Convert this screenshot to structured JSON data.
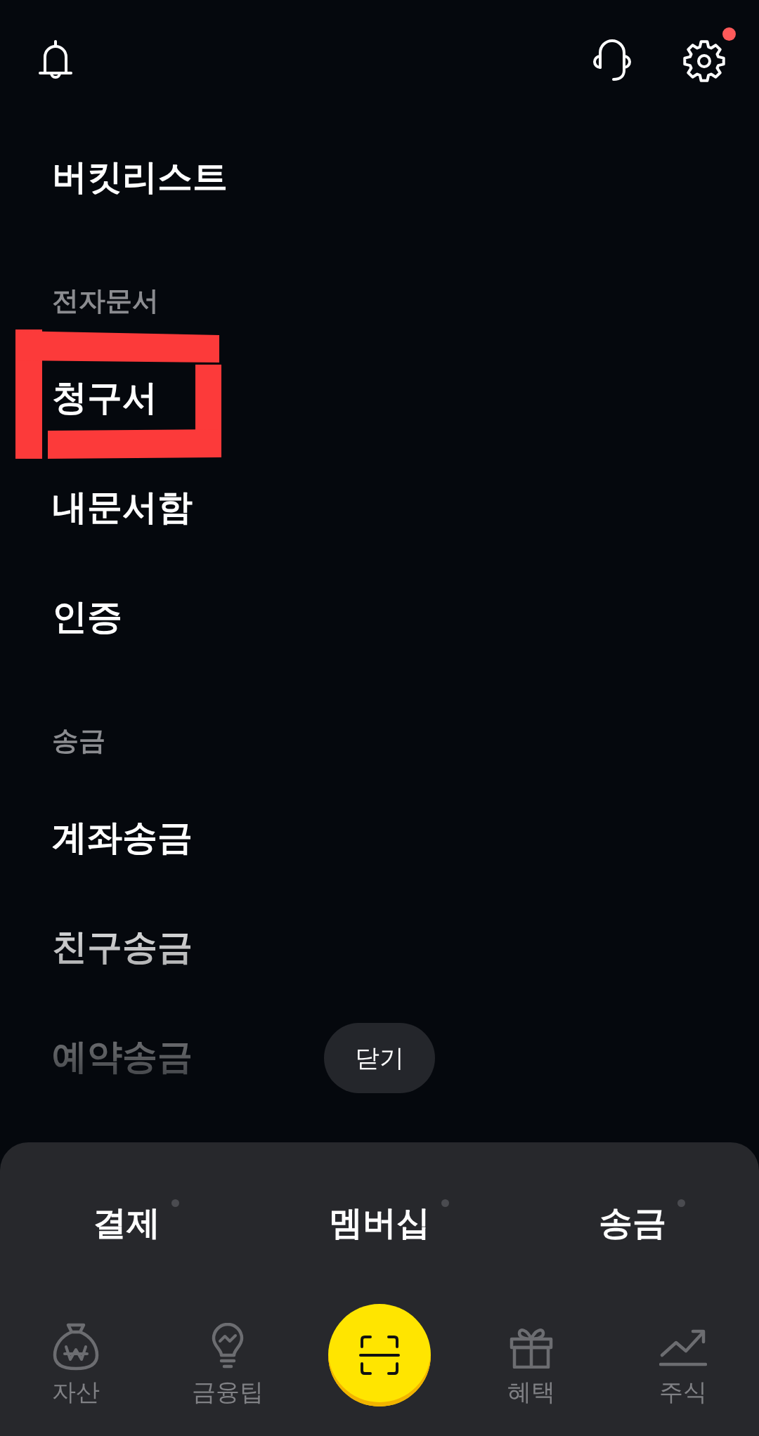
{
  "header": {
    "settings_badge": true
  },
  "menu": [
    {
      "kind": "item",
      "label": "버킷리스트",
      "annotated": false
    },
    {
      "kind": "section",
      "label": "전자문서"
    },
    {
      "kind": "item",
      "label": "청구서",
      "annotated": true
    },
    {
      "kind": "item",
      "label": "내문서함",
      "annotated": false
    },
    {
      "kind": "item",
      "label": "인증",
      "annotated": false
    },
    {
      "kind": "section",
      "label": "송금"
    },
    {
      "kind": "item",
      "label": "계좌송금",
      "annotated": false
    },
    {
      "kind": "item",
      "label": "친구송금",
      "annotated": false
    },
    {
      "kind": "item",
      "label": "예약송금",
      "annotated": false
    }
  ],
  "close_button": {
    "label": "닫기"
  },
  "tabs": [
    {
      "label": "결제",
      "indicator": true
    },
    {
      "label": "멤버십",
      "indicator": true
    },
    {
      "label": "송금",
      "indicator": true
    }
  ],
  "bottom_nav": [
    {
      "kind": "tab",
      "label": "자산"
    },
    {
      "kind": "tab",
      "label": "금융팁"
    },
    {
      "kind": "scan"
    },
    {
      "kind": "tab",
      "label": "혜택"
    },
    {
      "kind": "tab",
      "label": "주식"
    }
  ]
}
